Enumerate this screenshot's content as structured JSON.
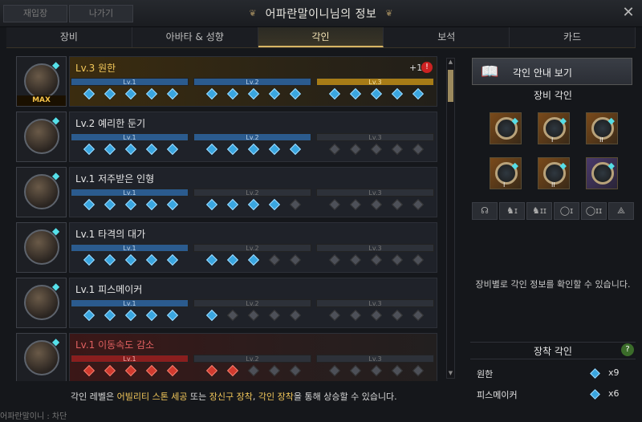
{
  "window": {
    "title": "어파란말이니님의 정보",
    "close_glyph": "✕",
    "ghost_tabs": [
      "재입장",
      "나가기"
    ]
  },
  "tabs": [
    {
      "label": "장비",
      "active": false
    },
    {
      "label": "아바타 & 성향",
      "active": false
    },
    {
      "label": "각인",
      "active": true
    },
    {
      "label": "보석",
      "active": false
    },
    {
      "label": "카드",
      "active": false
    }
  ],
  "engravings": [
    {
      "name": "Lv.3 원한",
      "style": "gold",
      "max": "MAX",
      "plus": "+1",
      "warn": "!",
      "levels": [
        "Lv.1",
        "Lv.2",
        "Lv.3"
      ],
      "fill": 3,
      "gems": 15,
      "active_gems": 15,
      "gem_color": "blue"
    },
    {
      "name": "Lv.2 예리한 둔기",
      "style": "normal",
      "levels": [
        "Lv.1",
        "Lv.2",
        "Lv.3"
      ],
      "fill": 2,
      "gems": 15,
      "active_gems": 10,
      "gem_color": "blue"
    },
    {
      "name": "Lv.1 저주받은 인형",
      "style": "normal",
      "levels": [
        "Lv.1",
        "Lv.2",
        "Lv.3"
      ],
      "fill": 1,
      "gems": 15,
      "active_gems": 9,
      "gem_color": "blue"
    },
    {
      "name": "Lv.1 타격의 대가",
      "style": "normal",
      "levels": [
        "Lv.1",
        "Lv.2",
        "Lv.3"
      ],
      "fill": 1,
      "gems": 15,
      "active_gems": 8,
      "gem_color": "blue"
    },
    {
      "name": "Lv.1 피스메이커",
      "style": "normal",
      "levels": [
        "Lv.1",
        "Lv.2",
        "Lv.3"
      ],
      "fill": 1,
      "gems": 15,
      "active_gems": 6,
      "gem_color": "blue"
    },
    {
      "name": "Lv.1 이동속도 감소",
      "style": "red",
      "levels": [
        "Lv.1",
        "Lv.2",
        "Lv.3"
      ],
      "fill": 1,
      "gems": 15,
      "active_gems": 7,
      "gem_color": "red"
    }
  ],
  "right": {
    "guide_label": "각인 안내 보기",
    "equip_engrave_title": "장비 각인",
    "slots": [
      {
        "name": "necklace",
        "roman": ""
      },
      {
        "name": "earring-1",
        "roman": "I"
      },
      {
        "name": "earring-2",
        "roman": "II"
      },
      {
        "name": "ring-1",
        "roman": "I"
      },
      {
        "name": "ring-2",
        "roman": "II"
      },
      {
        "name": "stone",
        "roman": ""
      }
    ],
    "filters": [
      "necklace",
      "earring-I",
      "earring-II",
      "ring-I",
      "ring-II",
      "stone"
    ],
    "filter_glyphs": [
      "☊",
      "♞ɪ",
      "♞ɪɪ",
      "◯ɪ",
      "◯ɪɪ",
      "⟁"
    ],
    "info_text": "장비별로 각인 정보를 확인할 수 있습니다.",
    "equipped_title": "장착 각인",
    "help": "?",
    "equipped": [
      {
        "name": "원한",
        "count": "x9"
      },
      {
        "name": "피스메이커",
        "count": "x6"
      }
    ]
  },
  "footer": {
    "pre": "각인 레벨은 ",
    "hl1": "어빌리티 스톤 세공",
    "mid1": " 또는 ",
    "hl2": "장신구 장착",
    "mid2": ", ",
    "hl3": "각인 장착",
    "post": "을 통해 상승할 수 있습니다."
  },
  "status_line": "어파란말이니 : 차단",
  "colors": {
    "gold": "#f2c75a",
    "blue_gem": "#3aa6e0",
    "red_gem": "#d13a2e",
    "accent": "#d7b565"
  }
}
